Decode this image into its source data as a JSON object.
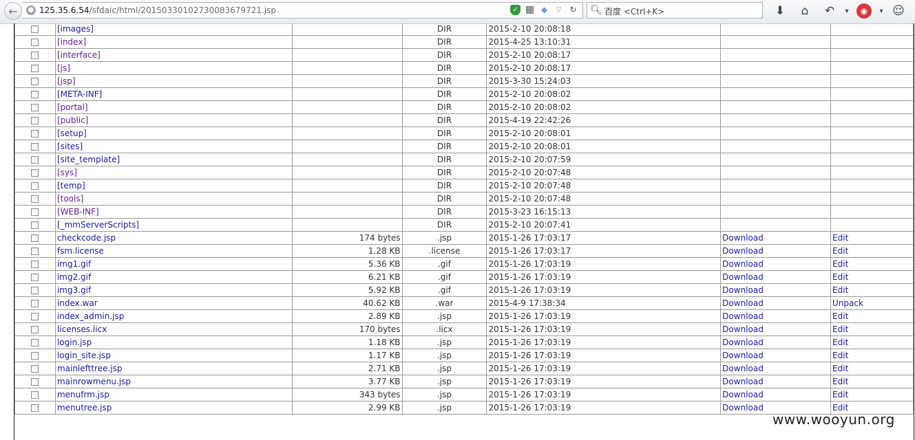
{
  "browser": {
    "url_host": "125.35.6.54",
    "url_path": "/sfdaic/html/20150330102730083679721.jsp",
    "search_placeholder": "百度 <Ctrl+K>"
  },
  "rows": [
    {
      "name": "[images]",
      "size": "",
      "type": "DIR",
      "date": "2015-2-10 20:08:18",
      "download": "",
      "action": "",
      "kind": "dir-blue"
    },
    {
      "name": "[index]",
      "size": "",
      "type": "DIR",
      "date": "2015-4-25 13:10:31",
      "download": "",
      "action": "",
      "kind": "dir"
    },
    {
      "name": "[interface]",
      "size": "",
      "type": "DIR",
      "date": "2015-2-10 20:08:17",
      "download": "",
      "action": "",
      "kind": "dir"
    },
    {
      "name": "[js]",
      "size": "",
      "type": "DIR",
      "date": "2015-2-10 20:08:17",
      "download": "",
      "action": "",
      "kind": "dir"
    },
    {
      "name": "[jsp]",
      "size": "",
      "type": "DIR",
      "date": "2015-3-30 15:24:03",
      "download": "",
      "action": "",
      "kind": "dir"
    },
    {
      "name": "[META-INF]",
      "size": "",
      "type": "DIR",
      "date": "2015-2-10 20:08:02",
      "download": "",
      "action": "",
      "kind": "dir-blue"
    },
    {
      "name": "[portal]",
      "size": "",
      "type": "DIR",
      "date": "2015-2-10 20:08:02",
      "download": "",
      "action": "",
      "kind": "dir"
    },
    {
      "name": "[public]",
      "size": "",
      "type": "DIR",
      "date": "2015-4-19 22:42:26",
      "download": "",
      "action": "",
      "kind": "dir"
    },
    {
      "name": "[setup]",
      "size": "",
      "type": "DIR",
      "date": "2015-2-10 20:08:01",
      "download": "",
      "action": "",
      "kind": "dir-blue"
    },
    {
      "name": "[sites]",
      "size": "",
      "type": "DIR",
      "date": "2015-2-10 20:08:01",
      "download": "",
      "action": "",
      "kind": "dir-blue"
    },
    {
      "name": "[site_template]",
      "size": "",
      "type": "DIR",
      "date": "2015-2-10 20:07:59",
      "download": "",
      "action": "",
      "kind": "dir-blue"
    },
    {
      "name": "[sys]",
      "size": "",
      "type": "DIR",
      "date": "2015-2-10 20:07:48",
      "download": "",
      "action": "",
      "kind": "dir"
    },
    {
      "name": "[temp]",
      "size": "",
      "type": "DIR",
      "date": "2015-2-10 20:07:48",
      "download": "",
      "action": "",
      "kind": "dir-blue"
    },
    {
      "name": "[tools]",
      "size": "",
      "type": "DIR",
      "date": "2015-2-10 20:07:48",
      "download": "",
      "action": "",
      "kind": "dir"
    },
    {
      "name": "[WEB-INF]",
      "size": "",
      "type": "DIR",
      "date": "2015-3-23 16:15:13",
      "download": "",
      "action": "",
      "kind": "dir"
    },
    {
      "name": "[_mmServerScripts]",
      "size": "",
      "type": "DIR",
      "date": "2015-2-10 20:07:41",
      "download": "",
      "action": "",
      "kind": "dir-blue"
    },
    {
      "name": "checkcode.jsp",
      "size": "174 bytes",
      "type": ".jsp",
      "date": "2015-1-26 17:03:17",
      "download": "Download",
      "action": "Edit",
      "kind": "file"
    },
    {
      "name": "fsm.license",
      "size": "1.28 KB",
      "type": ".license",
      "date": "2015-1-26 17:03:17",
      "download": "Download",
      "action": "Edit",
      "kind": "file"
    },
    {
      "name": "img1.gif",
      "size": "5.36 KB",
      "type": ".gif",
      "date": "2015-1-26 17:03:19",
      "download": "Download",
      "action": "Edit",
      "kind": "file"
    },
    {
      "name": "img2.gif",
      "size": "6.21 KB",
      "type": ".gif",
      "date": "2015-1-26 17:03:19",
      "download": "Download",
      "action": "Edit",
      "kind": "file"
    },
    {
      "name": "img3.gif",
      "size": "5.92 KB",
      "type": ".gif",
      "date": "2015-1-26 17:03:19",
      "download": "Download",
      "action": "Edit",
      "kind": "file"
    },
    {
      "name": "index.war",
      "size": "40.62 KB",
      "type": ".war",
      "date": "2015-4-9 17:38:34",
      "download": "Download",
      "action": "Unpack",
      "kind": "file"
    },
    {
      "name": "index_admin.jsp",
      "size": "2.89 KB",
      "type": ".jsp",
      "date": "2015-1-26 17:03:19",
      "download": "Download",
      "action": "Edit",
      "kind": "file"
    },
    {
      "name": "licenses.licx",
      "size": "170 bytes",
      "type": ".licx",
      "date": "2015-1-26 17:03:19",
      "download": "Download",
      "action": "Edit",
      "kind": "file"
    },
    {
      "name": "login.jsp",
      "size": "1.18 KB",
      "type": ".jsp",
      "date": "2015-1-26 17:03:19",
      "download": "Download",
      "action": "Edit",
      "kind": "file"
    },
    {
      "name": "login_site.jsp",
      "size": "1.17 KB",
      "type": ".jsp",
      "date": "2015-1-26 17:03:19",
      "download": "Download",
      "action": "Edit",
      "kind": "file"
    },
    {
      "name": "mainlefttree.jsp",
      "size": "2.71 KB",
      "type": ".jsp",
      "date": "2015-1-26 17:03:19",
      "download": "Download",
      "action": "Edit",
      "kind": "file"
    },
    {
      "name": "mainrowmenu.jsp",
      "size": "3.77 KB",
      "type": ".jsp",
      "date": "2015-1-26 17:03:19",
      "download": "Download",
      "action": "Edit",
      "kind": "file"
    },
    {
      "name": "menufrm.jsp",
      "size": "343 bytes",
      "type": ".jsp",
      "date": "2015-1-26 17:03:19",
      "download": "Download",
      "action": "Edit",
      "kind": "file"
    },
    {
      "name": "menutree.jsp",
      "size": "2.99 KB",
      "type": ".jsp",
      "date": "2015-1-26 17:03:19",
      "download": "Download",
      "action": "Edit",
      "kind": "file"
    }
  ],
  "watermark": "www.wooyun.org",
  "colors": {
    "link": "#1a1aa6",
    "visited": "#6a1b9a"
  }
}
